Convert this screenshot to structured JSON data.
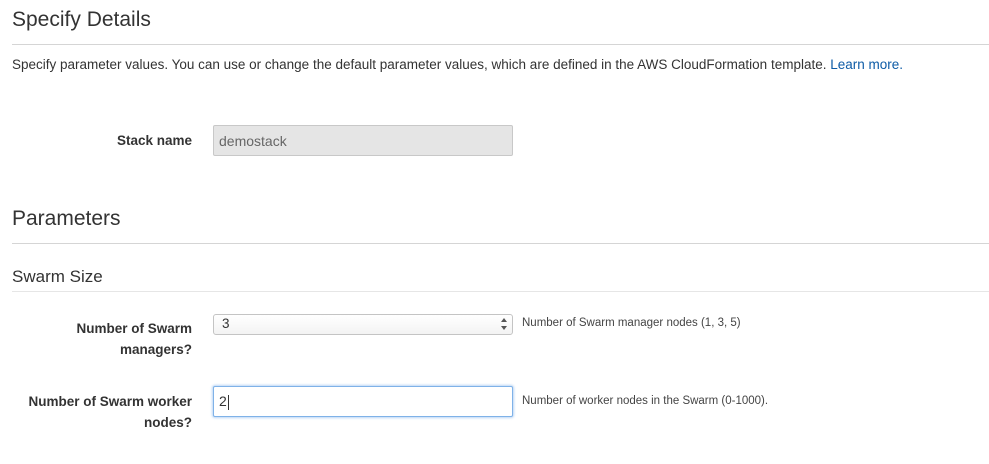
{
  "specify": {
    "title": "Specify Details",
    "intro_text": "Specify parameter values. You can use or change the default parameter values, which are defined in the AWS CloudFormation template.",
    "learn_more": "Learn more."
  },
  "stack": {
    "label": "Stack name",
    "value": "demostack"
  },
  "parameters": {
    "title": "Parameters",
    "group_title": "Swarm Size",
    "managers": {
      "label_line1": "Number of Swarm",
      "label_line2": "managers?",
      "selected_value": "3",
      "hint": "Number of Swarm manager nodes (1, 3, 5)"
    },
    "workers": {
      "label_line1": "Number of Swarm worker",
      "label_line2": "nodes?",
      "value": "2",
      "hint": "Number of worker nodes in the Swarm (0-1000)."
    }
  },
  "colors": {
    "link": "#0d5ba6",
    "focus_border": "#7fb2e8",
    "disabled_bg": "#e5e5e5"
  }
}
